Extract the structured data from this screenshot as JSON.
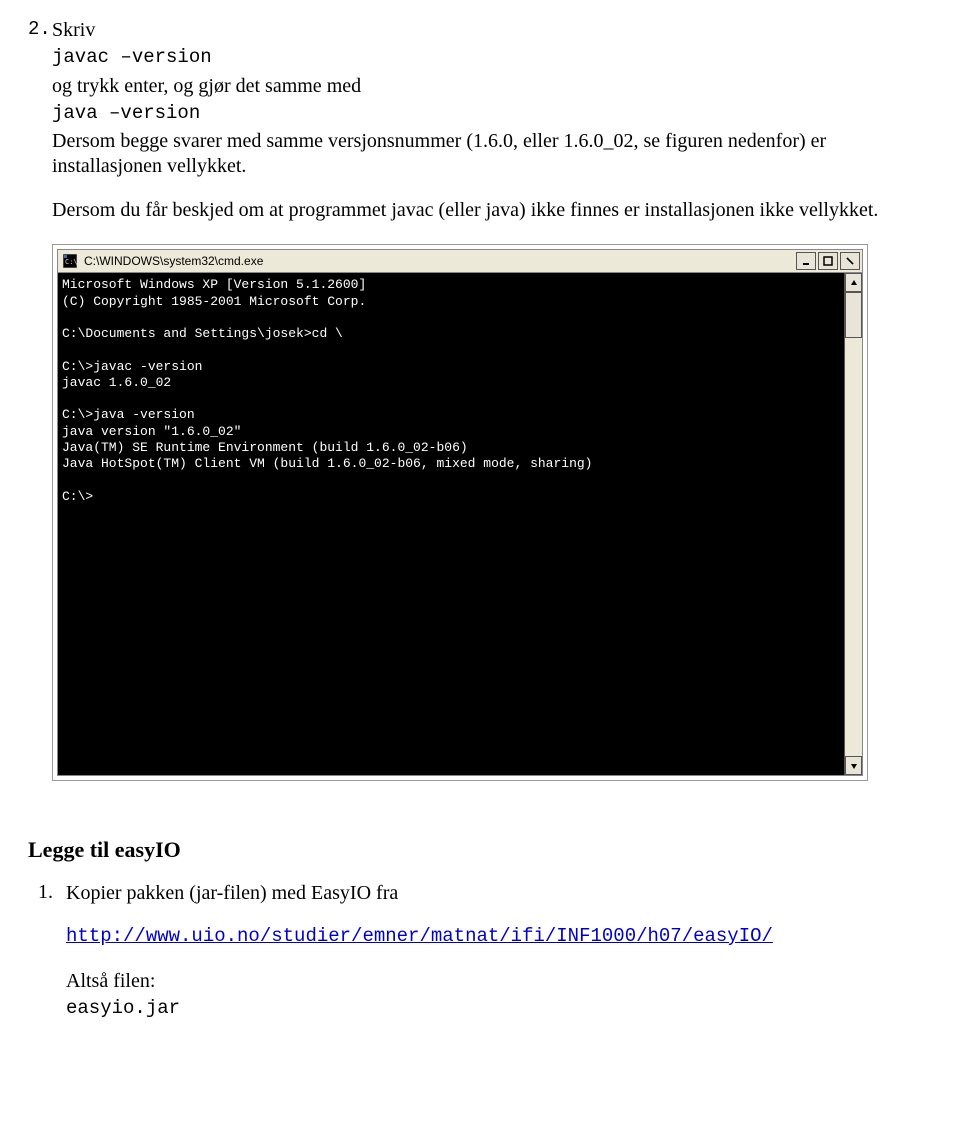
{
  "step2": {
    "num": "2.",
    "write": "Skriv",
    "cmd1": "javac –version",
    "line1b": "og trykk enter, og gjør det samme med",
    "cmd2": "java –version",
    "line2": "Dersom begge svarer med samme versjonsnummer (1.6.0, eller 1.6.0_02, se figuren nedenfor) er installasjonen vellykket.",
    "line3": "Dersom du får beskjed om at programmet javac (eller java) ikke finnes er installasjonen ikke vellykket."
  },
  "cmdwin": {
    "title": "C:\\WINDOWS\\system32\\cmd.exe",
    "lines": [
      "Microsoft Windows XP [Version 5.1.2600]",
      "(C) Copyright 1985-2001 Microsoft Corp.",
      "",
      "C:\\Documents and Settings\\josek>cd \\",
      "",
      "C:\\>javac -version",
      "javac 1.6.0_02",
      "",
      "C:\\>java -version",
      "java version \"1.6.0_02\"",
      "Java(TM) SE Runtime Environment (build 1.6.0_02-b06)",
      "Java HotSpot(TM) Client VM (build 1.6.0_02-b06, mixed mode, sharing)",
      "",
      "C:\\>"
    ]
  },
  "easyio": {
    "heading": "Legge til easyIO",
    "step1_num": "1.",
    "step1_text": "Kopier pakken (jar-filen) med EasyIO fra",
    "url": "http://www.uio.no/studier/emner/matnat/ifi/INF1000/h07/easyIO/",
    "altsa": "Altså filen:",
    "file": "easyio.jar"
  }
}
